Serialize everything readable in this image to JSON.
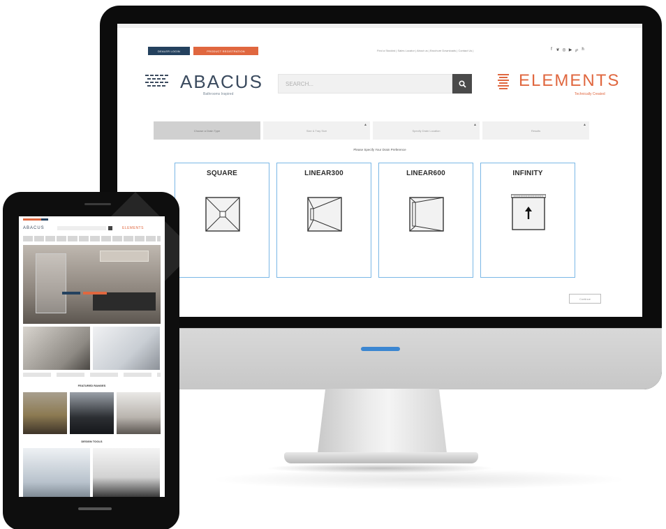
{
  "screen": {
    "buttons": {
      "dealer_login": "DEALER LOGIN",
      "product_registration": "PRODUCT REGISTRATION"
    },
    "top_links": "Find a Stockist | Sales Locator | About us | Brochure Downloads | Contact Us |",
    "social_icons": [
      "facebook-icon",
      "twitter-icon",
      "instagram-icon",
      "youtube-icon",
      "pinterest-icon",
      "houzz-icon"
    ],
    "social_glyphs": [
      "f",
      "❦",
      "◎",
      "▶",
      "℘",
      "h"
    ],
    "abacus": {
      "name": "ABACUS",
      "tagline": "Bathrooms Inspired"
    },
    "search": {
      "placeholder": "SEARCH...",
      "icon": "search-icon"
    },
    "elements": {
      "name": "ELEMENTS",
      "tagline": "Technically Created"
    },
    "steps": [
      {
        "label": "Choose a Drain Type",
        "active": true,
        "locked": false
      },
      {
        "label": "Size & Tray Size",
        "active": false,
        "locked": true
      },
      {
        "label": "Specify Drain Location",
        "active": false,
        "locked": true
      },
      {
        "label": "Results",
        "active": false,
        "locked": true
      }
    ],
    "prefs_title": "Please Specify Your Drain Preference",
    "cards": [
      {
        "label": "SQUARE"
      },
      {
        "label": "LINEAR300"
      },
      {
        "label": "LINEAR600"
      },
      {
        "label": "INFINITY"
      }
    ],
    "continue_label": "Continue",
    "colors": {
      "navy": "#24415e",
      "orange": "#e0673f",
      "card_border": "#7ab7e6",
      "device_black": "#0c0c0c",
      "monitor_led": "#3b86d1"
    }
  },
  "phone": {
    "logo": "ABACUS",
    "elements": "ELEMENTS",
    "featured_title": "FEATURED RANGES",
    "tools_title": "DESIGN TOOLS"
  }
}
